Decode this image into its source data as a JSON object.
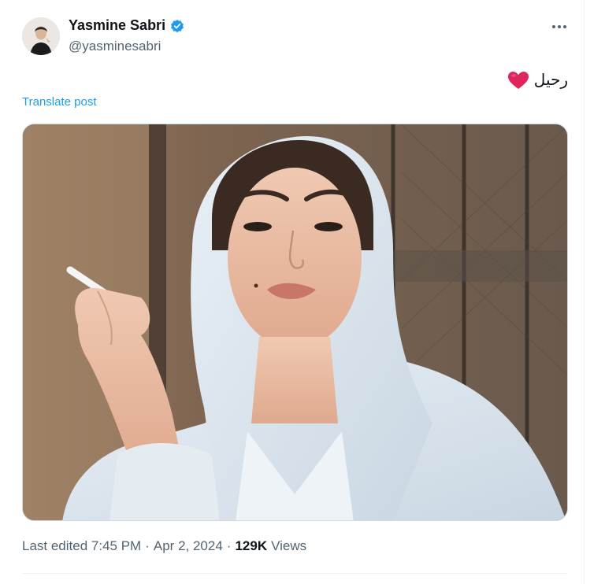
{
  "author": {
    "display_name": "Yasmine Sabri",
    "handle": "@yasminesabri",
    "verified": true,
    "verified_icon": "verified-badge-icon",
    "avatar_icon": "profile-photo"
  },
  "menu": {
    "more_icon": "more-horizontal-icon"
  },
  "post": {
    "text": "رحيل",
    "emoji_icon": "red-heart-icon",
    "translate_label": "Translate post",
    "image_description_icon": "post-photo"
  },
  "meta": {
    "edited_time": "Last edited 7:45 PM",
    "separator": "·",
    "date": "Apr 2, 2024",
    "views_count": "129K",
    "views_label": "Views"
  },
  "colors": {
    "accent": "#1d9bf0",
    "heart": "#e0245e",
    "secondary_text": "#536471",
    "primary_text": "#0f1419"
  }
}
